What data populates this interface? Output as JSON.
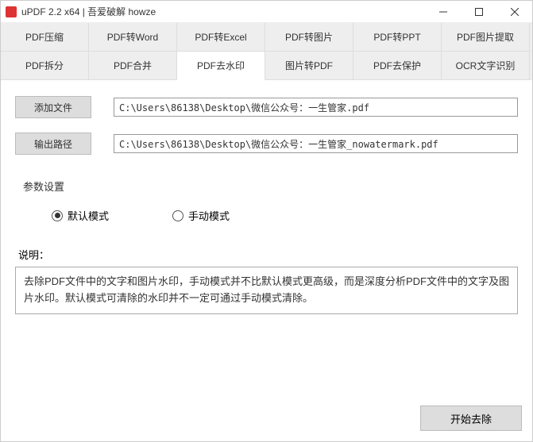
{
  "window": {
    "title": "uPDF 2.2 x64 | 吾爱破解 howze"
  },
  "tabs": {
    "row1": [
      "PDF压缩",
      "PDF转Word",
      "PDF转Excel",
      "PDF转图片",
      "PDF转PPT",
      "PDF图片提取"
    ],
    "row2": [
      "PDF拆分",
      "PDF合并",
      "PDF去水印",
      "图片转PDF",
      "PDF去保护",
      "OCR文字识别"
    ],
    "active": "PDF去水印"
  },
  "buttons": {
    "add_file": "添加文件",
    "output_path": "输出路径",
    "start": "开始去除"
  },
  "paths": {
    "input": "C:\\Users\\86138\\Desktop\\微信公众号：一生管家.pdf",
    "output": "C:\\Users\\86138\\Desktop\\微信公众号：一生管家_nowatermark.pdf"
  },
  "params": {
    "section_label": "参数设置",
    "mode_default": "默认模式",
    "mode_manual": "手动模式",
    "selected": "default"
  },
  "description": {
    "label": "说明：",
    "text": "去除PDF文件中的文字和图片水印，手动模式并不比默认模式更高级，而是深度分析PDF文件中的文字及图片水印。默认模式可清除的水印并不一定可通过手动模式清除。"
  }
}
